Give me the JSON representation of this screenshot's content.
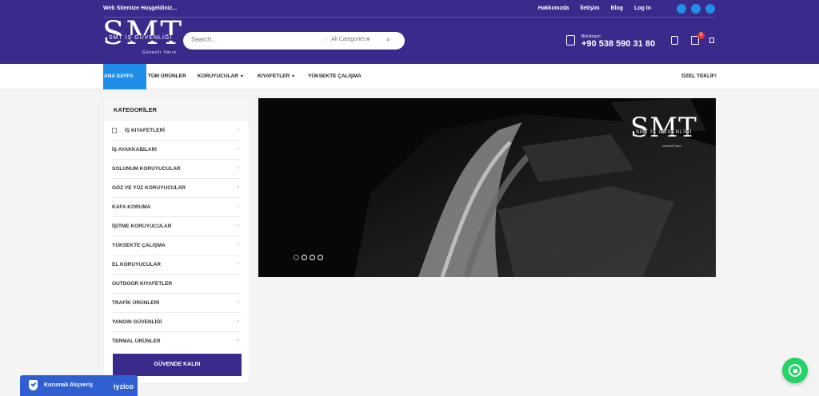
{
  "topbar": {
    "welcome": "Web Sitemize Hoşgeldiniz...",
    "links": [
      "Hakkımızda",
      "İletişim",
      "Blog",
      "Log In"
    ],
    "social_icons": [
      "facebook-icon",
      "instagram-icon",
      "twitter-icon"
    ]
  },
  "logo": {
    "main": "SMT",
    "sub": "SMT İŞ GÜVENLİĞİ",
    "sign": "Güvenli Yarın"
  },
  "search": {
    "placeholder": "Search...",
    "category": "All Categories",
    "button_icon": "search-icon"
  },
  "contact": {
    "label": "Bizi Arayın",
    "phone": "+90 538 590 31 80"
  },
  "cart": {
    "count": "0"
  },
  "nav": {
    "items": [
      {
        "label": "ANA SAYFA",
        "dropdown": false
      },
      {
        "label": "TÜM ÜRÜNLER",
        "dropdown": false
      },
      {
        "label": "KORUYUCULAR",
        "dropdown": true
      },
      {
        "label": "KIYAFETLER",
        "dropdown": true
      },
      {
        "label": "YÜKSEKTE ÇALIŞMA",
        "dropdown": false
      }
    ],
    "right": "ÖZEL TEKLİF!"
  },
  "sidebar": {
    "title": "KATEGORİLER",
    "items": [
      "İŞ KIYAFETLERİ",
      "İŞ AYAKKABILARI",
      "SOLUNUM KORUYUCULAR",
      "GÖZ VE YÜZ KORUYUCULAR",
      "KAFA KORUMA",
      "İŞİTME KORUYUCULAR",
      "YÜKSEKTE ÇALIŞMA",
      "EL KORUYUCULAR",
      "OUTDOOR KIYAFETLER",
      "TRAFİK ÜRÜNLERİ",
      "YANGIN GÜVENLİĞİ",
      "TERMAL ÜRÜNLER"
    ],
    "button": "GÜVENDE KALIN"
  },
  "slider": {
    "logo_main": "SMT",
    "logo_sub": "SMT İŞ GÜVENLİĞİ",
    "logo_sign": "Güvenli Yarın",
    "slides": 4,
    "active_slide": 1
  },
  "badge": {
    "text": "Korumalı Alışveriş",
    "brand": "iyzico"
  },
  "colors": {
    "primary": "#3a2a8c",
    "accent": "#1f8ee8",
    "whatsapp": "#25d366"
  }
}
